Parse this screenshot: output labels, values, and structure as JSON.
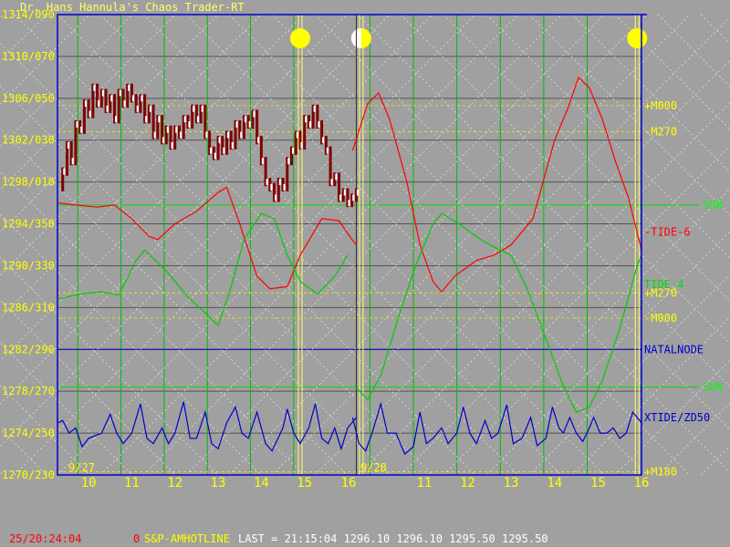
{
  "chart_data": {
    "type": "line",
    "title": "Dr. Hans Hannula's Chaos Trader-RT",
    "price_axis": {
      "labels": [
        "1314/090",
        "1310/070",
        "1306/050",
        "1302/030",
        "1298/010",
        "1294/350",
        "1290/330",
        "1286/310",
        "1282/290",
        "1278/270",
        "1274/250",
        "1270/230"
      ],
      "ylim": [
        1270,
        1314
      ]
    },
    "time_axis": {
      "labels": [
        "10",
        "11",
        "12",
        "13",
        "14",
        "15",
        "16",
        "11",
        "12",
        "13",
        "14",
        "15",
        "16"
      ],
      "date_labels": [
        "9/27",
        "9/28"
      ],
      "sessions": [
        {
          "date": "9/27",
          "hours": [
            9.3,
            16
          ]
        },
        {
          "date": "9/28",
          "hours": [
            9.3,
            16
          ]
        }
      ]
    },
    "right_labels": [
      {
        "text": "+M000",
        "value": 1305.3,
        "color": "#ffff00"
      },
      {
        "text": "-M270",
        "value": 1302.8,
        "color": "#ffff00"
      },
      {
        "text": "-TIDE-6",
        "value": 1293.2,
        "color": "#ff0000"
      },
      {
        "text": "TIDE-4",
        "value": 1288.2,
        "color": "#00dd00"
      },
      {
        "text": "+M270",
        "value": 1287.4,
        "color": "#ffff00"
      },
      {
        "text": "-M000",
        "value": 1285.0,
        "color": "#ffff00"
      },
      {
        "text": "NATALNODE",
        "value": 1282.0,
        "color": "#0000cc"
      },
      {
        "text": "XTIDE/ZD50",
        "value": 1275.5,
        "color": "#0000cc"
      },
      {
        "text": "+M180",
        "value": 1270.3,
        "color": "#ffff00"
      }
    ],
    "sun_labels": [
      {
        "text": "SUN",
        "value": 1295.8
      },
      {
        "text": "SUN",
        "value": 1278.4
      }
    ],
    "event_lines": [
      {
        "session": 0,
        "hour": 14.9,
        "symbol": "full-moon"
      },
      {
        "session": 1,
        "hour": 9.55,
        "symbol": "half-moon"
      },
      {
        "session": 1,
        "hour": 15.9,
        "symbol": "full-moon"
      }
    ],
    "cursor": {
      "session": 0,
      "hour": 16.2
    },
    "series": [
      {
        "name": "TIDE-6",
        "color": "#ff0000",
        "points": [
          [
            0,
            9.3,
            1296.0
          ],
          [
            0,
            9.7,
            1295.8
          ],
          [
            0,
            10.2,
            1295.6
          ],
          [
            0,
            10.6,
            1295.8
          ],
          [
            0,
            11.0,
            1294.5
          ],
          [
            0,
            11.4,
            1292.8
          ],
          [
            0,
            11.6,
            1292.5
          ],
          [
            0,
            12.0,
            1294.0
          ],
          [
            0,
            12.5,
            1295.2
          ],
          [
            0,
            13.0,
            1297.0
          ],
          [
            0,
            13.2,
            1297.5
          ],
          [
            0,
            13.5,
            1294.0
          ],
          [
            0,
            13.9,
            1289.0
          ],
          [
            0,
            14.2,
            1287.8
          ],
          [
            0,
            14.6,
            1288.0
          ],
          [
            0,
            14.9,
            1291.0
          ],
          [
            0,
            15.4,
            1294.5
          ],
          [
            0,
            15.8,
            1294.3
          ],
          [
            0,
            16.1,
            1292.5
          ],
          [
            0,
            16.2,
            1292.0
          ],
          [
            1,
            9.35,
            1301.0
          ],
          [
            1,
            9.7,
            1305.5
          ],
          [
            1,
            9.95,
            1306.5
          ],
          [
            1,
            10.2,
            1304.0
          ],
          [
            1,
            10.6,
            1298.0
          ],
          [
            1,
            10.9,
            1292.0
          ],
          [
            1,
            11.2,
            1288.5
          ],
          [
            1,
            11.4,
            1287.5
          ],
          [
            1,
            11.7,
            1289.0
          ],
          [
            1,
            12.2,
            1290.5
          ],
          [
            1,
            12.6,
            1291.0
          ],
          [
            1,
            13.0,
            1292.0
          ],
          [
            1,
            13.5,
            1294.5
          ],
          [
            1,
            14.0,
            1302.0
          ],
          [
            1,
            14.3,
            1305.0
          ],
          [
            1,
            14.55,
            1308.0
          ],
          [
            1,
            14.8,
            1307.0
          ],
          [
            1,
            15.1,
            1304.0
          ],
          [
            1,
            15.4,
            1300.0
          ],
          [
            1,
            15.7,
            1296.5
          ],
          [
            1,
            16.0,
            1291.5
          ]
        ]
      },
      {
        "name": "TIDE-4",
        "color": "#00cc00",
        "points": [
          [
            0,
            9.3,
            1286.8
          ],
          [
            0,
            9.8,
            1287.3
          ],
          [
            0,
            10.3,
            1287.5
          ],
          [
            0,
            10.7,
            1287.2
          ],
          [
            0,
            11.1,
            1290.5
          ],
          [
            0,
            11.3,
            1291.5
          ],
          [
            0,
            11.8,
            1289.5
          ],
          [
            0,
            12.3,
            1287.0
          ],
          [
            0,
            12.7,
            1285.5
          ],
          [
            0,
            13.0,
            1284.3
          ],
          [
            0,
            13.3,
            1288.0
          ],
          [
            0,
            13.6,
            1292.5
          ],
          [
            0,
            14.0,
            1295.0
          ],
          [
            0,
            14.3,
            1294.5
          ],
          [
            0,
            14.6,
            1291.0
          ],
          [
            0,
            14.9,
            1288.5
          ],
          [
            0,
            15.3,
            1287.3
          ],
          [
            0,
            15.7,
            1289.0
          ],
          [
            0,
            16.0,
            1291.0
          ],
          [
            1,
            9.4,
            1278.5
          ],
          [
            1,
            9.7,
            1277.2
          ],
          [
            1,
            10.0,
            1279.5
          ],
          [
            1,
            10.4,
            1285.0
          ],
          [
            1,
            10.8,
            1290.0
          ],
          [
            1,
            11.2,
            1294.0
          ],
          [
            1,
            11.4,
            1295.0
          ],
          [
            1,
            11.8,
            1294.0
          ],
          [
            1,
            12.3,
            1292.5
          ],
          [
            1,
            12.6,
            1291.8
          ],
          [
            1,
            13.0,
            1291.0
          ],
          [
            1,
            13.4,
            1287.5
          ],
          [
            1,
            13.8,
            1283.0
          ],
          [
            1,
            14.2,
            1278.5
          ],
          [
            1,
            14.5,
            1276.0
          ],
          [
            1,
            14.8,
            1276.5
          ],
          [
            1,
            15.1,
            1279.0
          ],
          [
            1,
            15.5,
            1284.0
          ],
          [
            1,
            15.9,
            1290.0
          ],
          [
            1,
            16.0,
            1291.0
          ]
        ]
      },
      {
        "name": "XTIDE/ZD50",
        "color": "#0000cc",
        "points": [
          [
            0,
            9.3,
            1275.0
          ],
          [
            0,
            9.4,
            1275.2
          ],
          [
            0,
            9.55,
            1274.0
          ],
          [
            0,
            9.7,
            1274.5
          ],
          [
            0,
            9.85,
            1272.7
          ],
          [
            0,
            10.0,
            1273.5
          ],
          [
            0,
            10.3,
            1274.0
          ],
          [
            0,
            10.5,
            1275.8
          ],
          [
            0,
            10.65,
            1274.0
          ],
          [
            0,
            10.8,
            1273.0
          ],
          [
            0,
            11.0,
            1274.0
          ],
          [
            0,
            11.2,
            1276.8
          ],
          [
            0,
            11.35,
            1273.5
          ],
          [
            0,
            11.5,
            1273.0
          ],
          [
            0,
            11.7,
            1274.5
          ],
          [
            0,
            11.85,
            1273.0
          ],
          [
            0,
            12.0,
            1274.0
          ],
          [
            0,
            12.2,
            1277.0
          ],
          [
            0,
            12.35,
            1273.5
          ],
          [
            0,
            12.5,
            1273.5
          ],
          [
            0,
            12.7,
            1276.0
          ],
          [
            0,
            12.85,
            1273.0
          ],
          [
            0,
            13.0,
            1272.5
          ],
          [
            0,
            13.2,
            1275.0
          ],
          [
            0,
            13.4,
            1276.5
          ],
          [
            0,
            13.55,
            1274.0
          ],
          [
            0,
            13.7,
            1273.5
          ],
          [
            0,
            13.9,
            1276.0
          ],
          [
            0,
            14.1,
            1273.0
          ],
          [
            0,
            14.25,
            1272.3
          ],
          [
            0,
            14.5,
            1274.5
          ],
          [
            0,
            14.6,
            1276.3
          ],
          [
            0,
            14.75,
            1274.0
          ],
          [
            0,
            14.9,
            1273.0
          ],
          [
            0,
            15.1,
            1274.5
          ],
          [
            0,
            15.25,
            1276.8
          ],
          [
            0,
            15.4,
            1273.5
          ],
          [
            0,
            15.55,
            1273.0
          ],
          [
            0,
            15.7,
            1274.5
          ],
          [
            0,
            15.85,
            1272.5
          ],
          [
            0,
            16.0,
            1274.5
          ],
          [
            0,
            16.2,
            1275.5
          ],
          [
            1,
            9.35,
            1275.5
          ],
          [
            1,
            9.5,
            1273.0
          ],
          [
            1,
            9.65,
            1272.3
          ],
          [
            1,
            9.8,
            1274.0
          ],
          [
            1,
            10.0,
            1276.8
          ],
          [
            1,
            10.15,
            1274.0
          ],
          [
            1,
            10.35,
            1274.0
          ],
          [
            1,
            10.55,
            1272.0
          ],
          [
            1,
            10.75,
            1272.7
          ],
          [
            1,
            10.9,
            1276.0
          ],
          [
            1,
            11.05,
            1273.0
          ],
          [
            1,
            11.2,
            1273.5
          ],
          [
            1,
            11.4,
            1274.5
          ],
          [
            1,
            11.55,
            1273.0
          ],
          [
            1,
            11.75,
            1274.0
          ],
          [
            1,
            11.9,
            1276.5
          ],
          [
            1,
            12.05,
            1274.0
          ],
          [
            1,
            12.2,
            1273.0
          ],
          [
            1,
            12.4,
            1275.2
          ],
          [
            1,
            12.55,
            1273.5
          ],
          [
            1,
            12.7,
            1274.0
          ],
          [
            1,
            12.9,
            1276.7
          ],
          [
            1,
            13.05,
            1273.0
          ],
          [
            1,
            13.25,
            1273.5
          ],
          [
            1,
            13.45,
            1275.5
          ],
          [
            1,
            13.6,
            1272.8
          ],
          [
            1,
            13.8,
            1273.5
          ],
          [
            1,
            13.95,
            1276.5
          ],
          [
            1,
            14.1,
            1274.5
          ],
          [
            1,
            14.2,
            1274.0
          ],
          [
            1,
            14.35,
            1275.5
          ],
          [
            1,
            14.5,
            1274.0
          ],
          [
            1,
            14.65,
            1273.2
          ],
          [
            1,
            14.8,
            1274.5
          ],
          [
            1,
            14.9,
            1275.5
          ],
          [
            1,
            15.05,
            1274.0
          ],
          [
            1,
            15.2,
            1274.0
          ],
          [
            1,
            15.35,
            1274.5
          ],
          [
            1,
            15.5,
            1273.5
          ],
          [
            1,
            15.65,
            1274.0
          ],
          [
            1,
            15.8,
            1276.0
          ],
          [
            1,
            16.0,
            1275.0
          ]
        ]
      }
    ],
    "price_points": [
      [
        9.3,
        1297.5
      ],
      [
        9.4,
        1299
      ],
      [
        9.5,
        1301.5
      ],
      [
        9.6,
        1300
      ],
      [
        9.7,
        1303.5
      ],
      [
        9.8,
        1303
      ],
      [
        9.9,
        1305.5
      ],
      [
        10.0,
        1304.5
      ],
      [
        10.1,
        1307
      ],
      [
        10.2,
        1305.5
      ],
      [
        10.3,
        1306.5
      ],
      [
        10.4,
        1305
      ],
      [
        10.5,
        1306
      ],
      [
        10.6,
        1304
      ],
      [
        10.7,
        1306.5
      ],
      [
        10.8,
        1305.5
      ],
      [
        10.9,
        1307
      ],
      [
        11.0,
        1306
      ],
      [
        11.1,
        1305
      ],
      [
        11.2,
        1306
      ],
      [
        11.3,
        1304
      ],
      [
        11.4,
        1305
      ],
      [
        11.5,
        1302.5
      ],
      [
        11.6,
        1304
      ],
      [
        11.7,
        1302
      ],
      [
        11.8,
        1303
      ],
      [
        11.9,
        1301.5
      ],
      [
        12.0,
        1303
      ],
      [
        12.1,
        1302.5
      ],
      [
        12.2,
        1304
      ],
      [
        12.3,
        1303.5
      ],
      [
        12.4,
        1305
      ],
      [
        12.5,
        1304
      ],
      [
        12.6,
        1305
      ],
      [
        12.7,
        1302.5
      ],
      [
        12.8,
        1301
      ],
      [
        12.9,
        1300.5
      ],
      [
        13.0,
        1302
      ],
      [
        13.1,
        1301
      ],
      [
        13.2,
        1302.5
      ],
      [
        13.3,
        1301.5
      ],
      [
        13.4,
        1303.5
      ],
      [
        13.5,
        1302.5
      ],
      [
        13.6,
        1304
      ],
      [
        13.7,
        1303.5
      ],
      [
        13.8,
        1304.5
      ],
      [
        13.9,
        1302
      ],
      [
        14.0,
        1300
      ],
      [
        14.1,
        1298
      ],
      [
        14.2,
        1297.5
      ],
      [
        14.3,
        1296.5
      ],
      [
        14.4,
        1298
      ],
      [
        14.5,
        1297.5
      ],
      [
        14.6,
        1300
      ],
      [
        14.7,
        1301
      ],
      [
        14.8,
        1302.5
      ],
      [
        14.9,
        1301.5
      ],
      [
        15.0,
        1304
      ],
      [
        15.1,
        1303.5
      ],
      [
        15.2,
        1305
      ],
      [
        15.3,
        1303.5
      ],
      [
        15.4,
        1302
      ],
      [
        15.5,
        1301
      ],
      [
        15.6,
        1298
      ],
      [
        15.7,
        1298.5
      ],
      [
        15.8,
        1296.5
      ],
      [
        15.9,
        1297
      ],
      [
        16.0,
        1296
      ],
      [
        16.1,
        1296.5
      ],
      [
        16.2,
        1297
      ]
    ],
    "status": {
      "clock": "25/20:24:04",
      "zero": "0",
      "symbol": "S&P-AMHOTLINE",
      "quote": "LAST = 21:15:04 1296.10 1296.10 1295.50 1295.50"
    }
  }
}
